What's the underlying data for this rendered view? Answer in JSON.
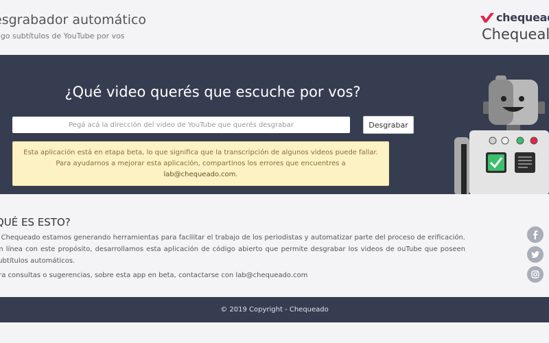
{
  "header": {
    "title": "esgrabador automático",
    "subtitle": "aigo subtítulos de YouTube por vos",
    "brand_logo_text": "chequeado",
    "brand_name": "Chequeal"
  },
  "hero": {
    "heading": "¿Qué video querés que escuche por vos?",
    "url_input": {
      "value": "",
      "placeholder": "Pegá acá la dirección del video de YouTube que querés desgrabar"
    },
    "submit_label": "Desgrabar",
    "alert_text": "Esta aplicación está en etapa beta, lo que significa que la transcripción de algunos videos puede fallar. Para ayudarnos a mejorar esta aplicación, compartinos los errores que encuentres a",
    "alert_email": "lab@chequeado.com",
    "alert_end": "."
  },
  "about": {
    "title": "QUÉ ES ESTO?",
    "text": "n Chequeado estamos generando herramientas para facilitar el trabajo de los periodistas y automatizar parte del proceso de erificación. En línea con este propósito, desarrollamos esta aplicación de código abierto que permite desgrabar los videos de ouTube que poseen subtítulos automáticos.",
    "contact": "ara consultas o sugerencias, sobre esta app en beta, contactarse con lab@chequeado.com"
  },
  "social": [
    {
      "name": "facebook-icon"
    },
    {
      "name": "twitter-icon"
    },
    {
      "name": "instagram-icon"
    }
  ],
  "footer": {
    "copyright": "© 2019 Copyright - Chequeado"
  },
  "colors": {
    "dark_band": "#363d50",
    "page_bg": "#f4f4f6",
    "alert_bg": "#fdf2c4",
    "alert_text": "#8a6d3b",
    "brand_red": "#e0284a",
    "social_grey": "#a9adb8",
    "robot_green": "#3cbf6b"
  }
}
